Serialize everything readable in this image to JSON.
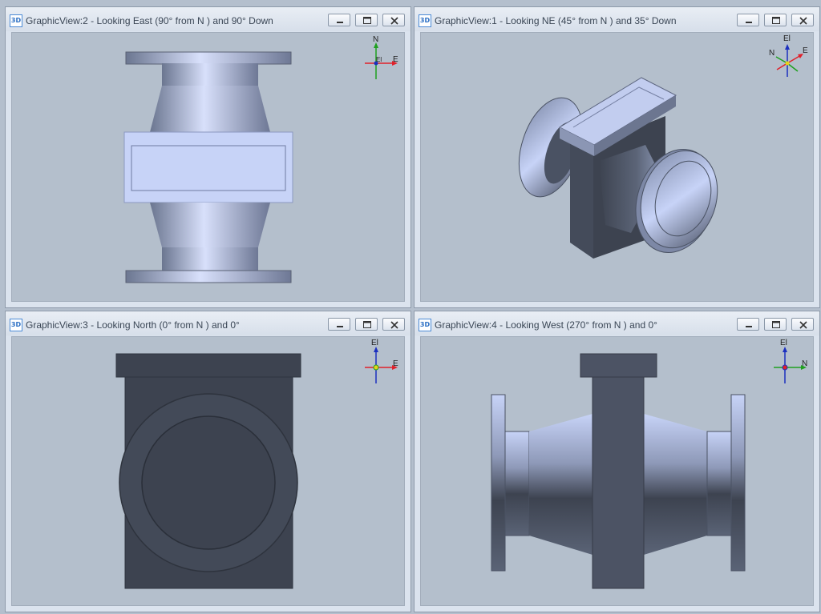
{
  "views": [
    {
      "title": "GraphicView:2 - Looking East (90° from N ) and 90° Down",
      "badge": "3D",
      "axis": {
        "up": "N",
        "right": "E",
        "center": "El"
      }
    },
    {
      "title": "GraphicView:1 - Looking NE (45° from N ) and 35° Down",
      "badge": "3D",
      "axis": {
        "up": "El",
        "right": "E",
        "left": "N"
      }
    },
    {
      "title": "GraphicView:3 - Looking North (0° from N ) and 0°",
      "badge": "3D",
      "axis": {
        "up": "El",
        "right": "E"
      }
    },
    {
      "title": "GraphicView:4 - Looking West (270° from N ) and 0°",
      "badge": "3D",
      "axis": {
        "up": "El",
        "right": "N"
      }
    }
  ],
  "colors": {
    "viewport_bg": "#b4bfcc",
    "model_light": "#c7d3f7",
    "model_dark": "#3d4350",
    "axis_x": "#e0202a",
    "axis_y": "#1fa01f",
    "axis_z": "#1b2fbf"
  }
}
